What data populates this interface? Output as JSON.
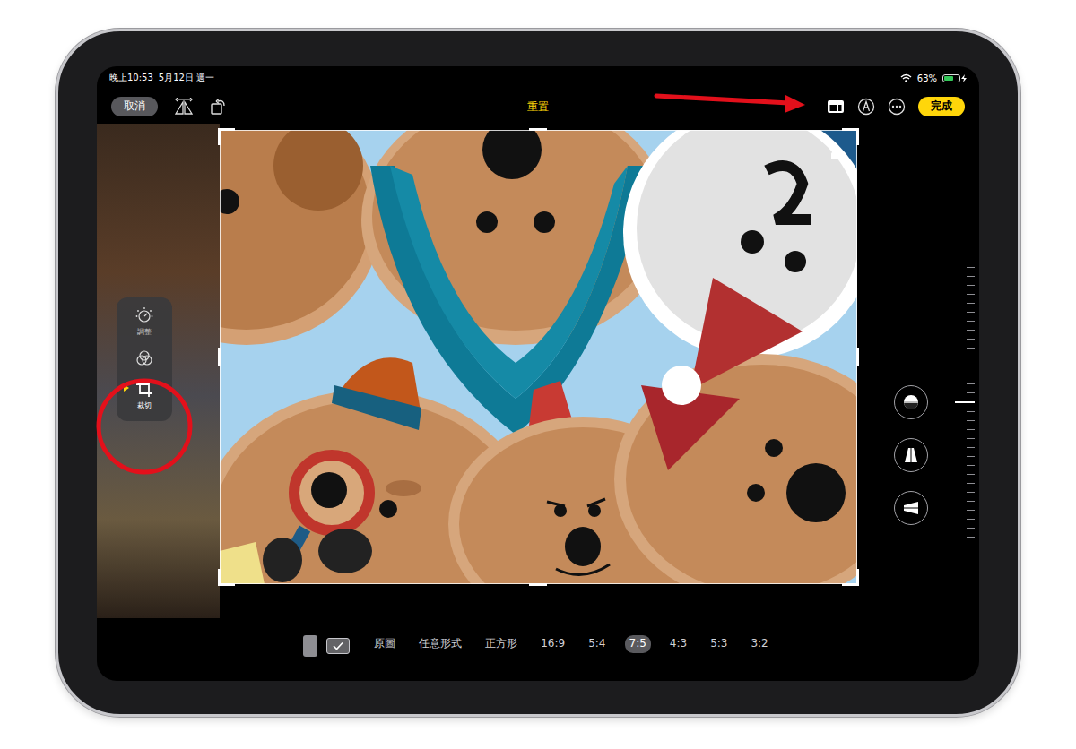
{
  "status_bar": {
    "time": "晚上10:53",
    "date": "5月12日 週一",
    "battery": "63%",
    "battery_level": 0.63,
    "charging": true
  },
  "toolbar": {
    "cancel": "取消",
    "title": "重置",
    "done": "完成"
  },
  "side_menu": [
    {
      "kind": "adjust",
      "label": "調整",
      "selected": false
    },
    {
      "kind": "filter",
      "selected": false
    },
    {
      "kind": "crop",
      "label": "裁切",
      "selected": true
    }
  ],
  "crop": {
    "aspect_locked": true
  },
  "straighten": {
    "level": 0.5
  },
  "perspective_buttons": [
    {
      "kind": "straighten"
    },
    {
      "kind": "vertical"
    },
    {
      "kind": "horizontal"
    }
  ],
  "orientations": [
    {
      "kind": "portrait",
      "selected": false
    },
    {
      "kind": "landscape",
      "selected": true
    }
  ],
  "aspect_ratios": [
    {
      "label": "原圖",
      "selected": false
    },
    {
      "label": "任意形式",
      "selected": false
    },
    {
      "label": "正方形",
      "selected": false
    },
    {
      "label": "16:9",
      "selected": false
    },
    {
      "label": "5:4",
      "selected": false
    },
    {
      "label": "7:5",
      "selected": true
    },
    {
      "label": "4:3",
      "selected": false
    },
    {
      "label": "5:3",
      "selected": false
    },
    {
      "label": "3:2",
      "selected": false
    }
  ]
}
